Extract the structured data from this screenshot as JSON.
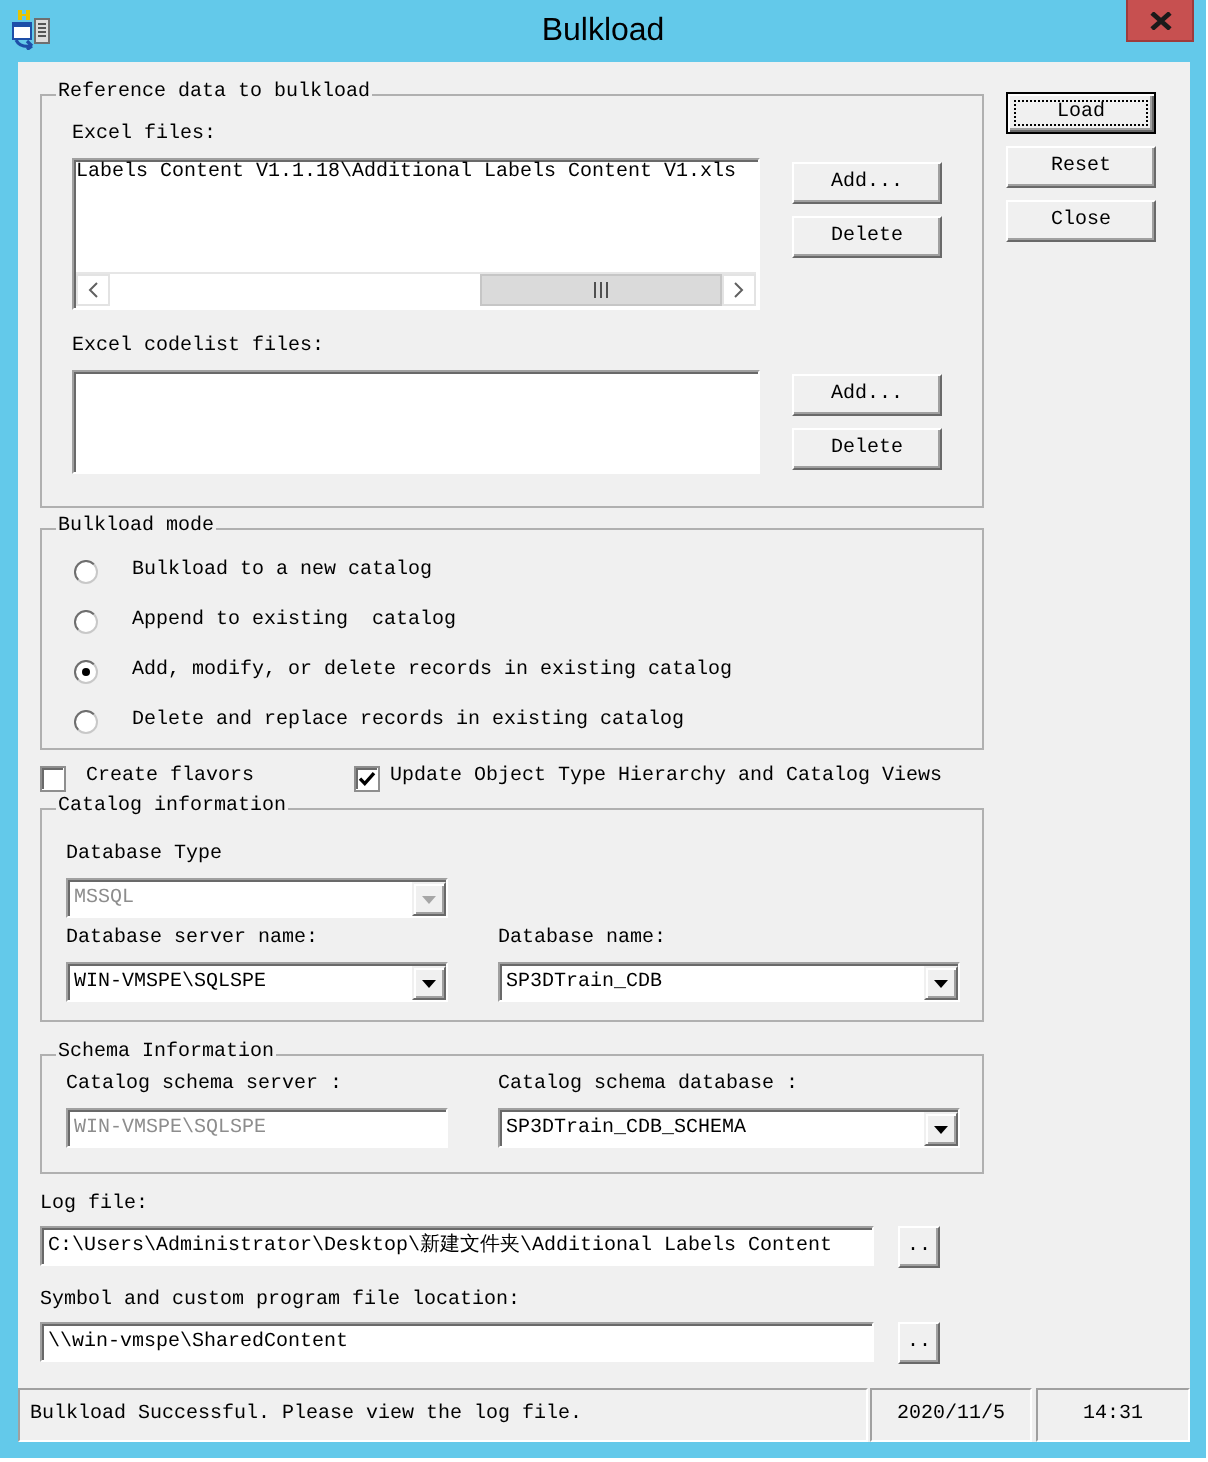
{
  "window": {
    "title": "Bulkload"
  },
  "reference_data": {
    "title": "Reference data to bulkload",
    "excel_files": {
      "label": "Excel files:",
      "items": [
        "Labels Content V1.1.18\\Additional Labels Content V1.xls"
      ],
      "buttons": [
        "Add...",
        "Delete"
      ]
    },
    "codelist_files": {
      "label": "Excel codelist files:",
      "buttons": [
        "Add...",
        "Delete"
      ]
    }
  },
  "actions": [
    {
      "label": "Load",
      "focused": true
    },
    {
      "label": "Reset",
      "focused": false
    },
    {
      "label": "Close",
      "focused": false
    }
  ],
  "mode": {
    "title": "Bulkload mode",
    "options": [
      {
        "label": "Bulkload to a new catalog",
        "selected": false
      },
      {
        "label": "Append to existing  catalog",
        "selected": false
      },
      {
        "label": "Add, modify, or delete records in existing catalog",
        "selected": true
      },
      {
        "label": "Delete and replace records in existing catalog",
        "selected": false
      }
    ]
  },
  "options": [
    {
      "label": "Create flavors",
      "checked": false
    },
    {
      "label": "Update Object Type Hierarchy and Catalog Views",
      "checked": true
    }
  ],
  "catalog": {
    "title": "Catalog information",
    "rows": [
      [
        {
          "label": "Database Type",
          "kind": "combo",
          "value": "MSSQL",
          "disabled": true
        }
      ],
      [
        {
          "label": "Database server name:",
          "kind": "combo",
          "value": "WIN-VMSPE\\SQLSPE",
          "disabled": false
        },
        {
          "label": "Database name:",
          "kind": "combo",
          "value": "SP3DTrain_CDB",
          "disabled": false
        }
      ]
    ]
  },
  "schema": {
    "title": "Schema Information",
    "rows": [
      [
        {
          "label": "Catalog schema server :",
          "kind": "text",
          "value": "WIN-VMSPE\\SQLSPE",
          "disabled": true
        },
        {
          "label": "Catalog schema database :",
          "kind": "combo",
          "value": "SP3DTrain_CDB_SCHEMA",
          "disabled": false
        }
      ]
    ]
  },
  "log_file": {
    "label": "Log file:",
    "value": "C:\\Users\\Administrator\\Desktop\\新建文件夹\\Additional Labels Content",
    "button": ".."
  },
  "symbol_location": {
    "label": "Symbol and custom program file location:",
    "value": "\\\\win-vmspe\\SharedContent",
    "button": ".."
  },
  "status_bar": {
    "message": "Bulkload Successful. Please view the log file.",
    "date": "2020/11/5",
    "time": "14:31"
  }
}
